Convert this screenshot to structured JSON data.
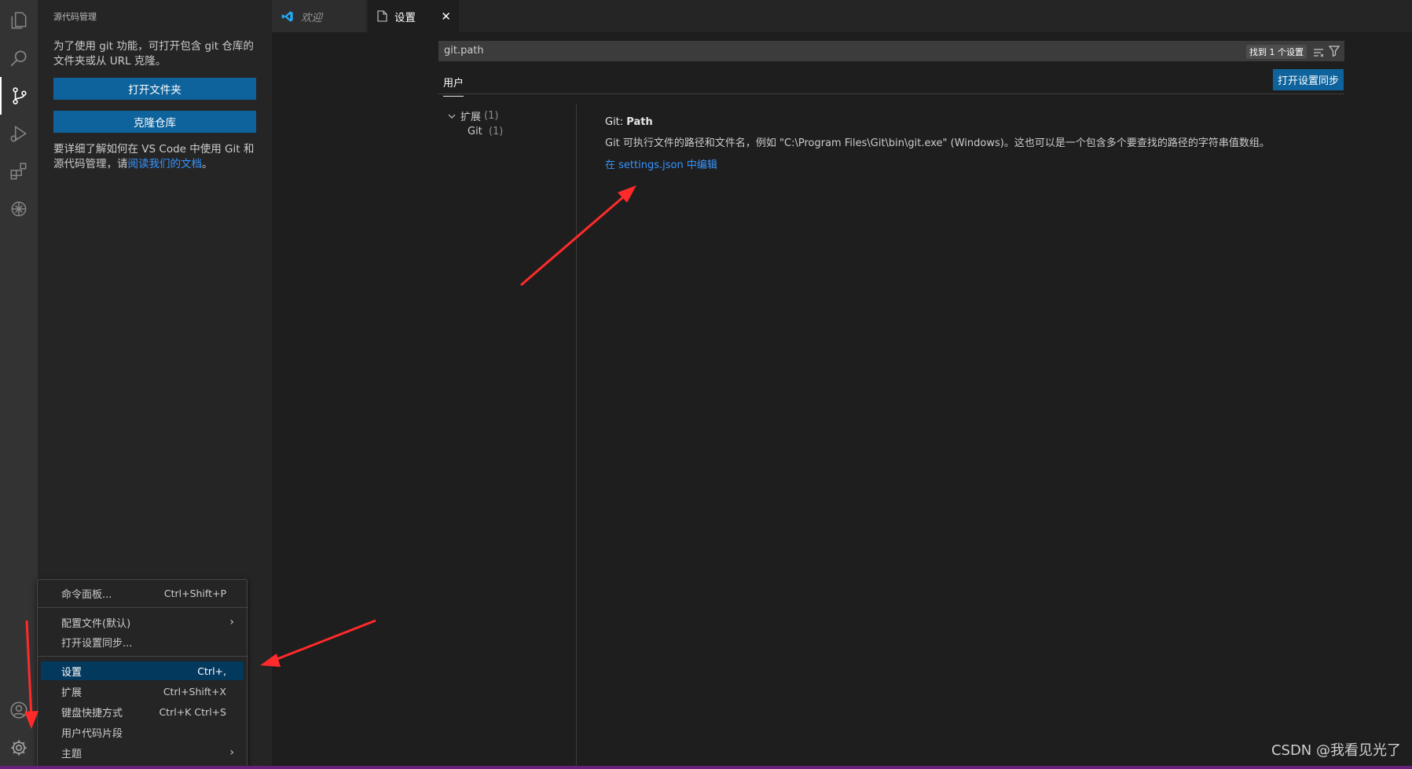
{
  "activity_bar": {
    "items": [
      "explorer-icon",
      "search-icon",
      "source-control-icon",
      "run-debug-icon",
      "extensions-icon",
      "openai-icon"
    ],
    "bottom": [
      "account-icon",
      "gear-icon"
    ]
  },
  "sidebar": {
    "title": "源代码管理",
    "intro": "为了使用 git 功能，可打开包含 git 仓库的文件夹或从 URL 克隆。",
    "open_folder": "打开文件夹",
    "clone_repo": "克隆仓库",
    "learn_prefix": "要详细了解如何在 VS Code 中使用 Git 和源代码管理，请",
    "learn_link": "阅读我们的文档",
    "learn_suffix": "。"
  },
  "tabs": {
    "welcome": "欢迎",
    "settings": "设置",
    "close": "✕"
  },
  "settings": {
    "search_value": "git.path",
    "result_count": "找到 1 个设置",
    "scope_tab": "用户",
    "sync_button": "打开设置同步",
    "toc_group": "扩展",
    "toc_group_count": "(1)",
    "toc_item": "Git",
    "toc_item_count": "(1)",
    "setting_category": "Git: ",
    "setting_name": "Path",
    "setting_description": "Git 可执行文件的路径和文件名，例如 \"C:\\Program Files\\Git\\bin\\git.exe\" (Windows)。这也可以是一个包含多个要查找的路径的字符串值数组。",
    "setting_link": "在 settings.json 中编辑"
  },
  "menu": {
    "items": [
      {
        "label": "命令面板...",
        "key": "Ctrl+Shift+P"
      },
      {
        "label": "配置文件(默认)",
        "arrow": "›"
      },
      {
        "label": "打开设置同步..."
      },
      {
        "label": "设置",
        "key": "Ctrl+,"
      },
      {
        "label": "扩展",
        "key": "Ctrl+Shift+X"
      },
      {
        "label": "键盘快捷方式",
        "key": "Ctrl+K Ctrl+S"
      },
      {
        "label": "用户代码片段"
      },
      {
        "label": "主题",
        "arrow": "›"
      }
    ]
  },
  "watermark": "CSDN @我看见光了",
  "colors": {
    "accent_button": "#0e639c",
    "link": "#3794ff",
    "annotation_arrow": "#ff2a2a",
    "status_bar": "#68217a"
  }
}
